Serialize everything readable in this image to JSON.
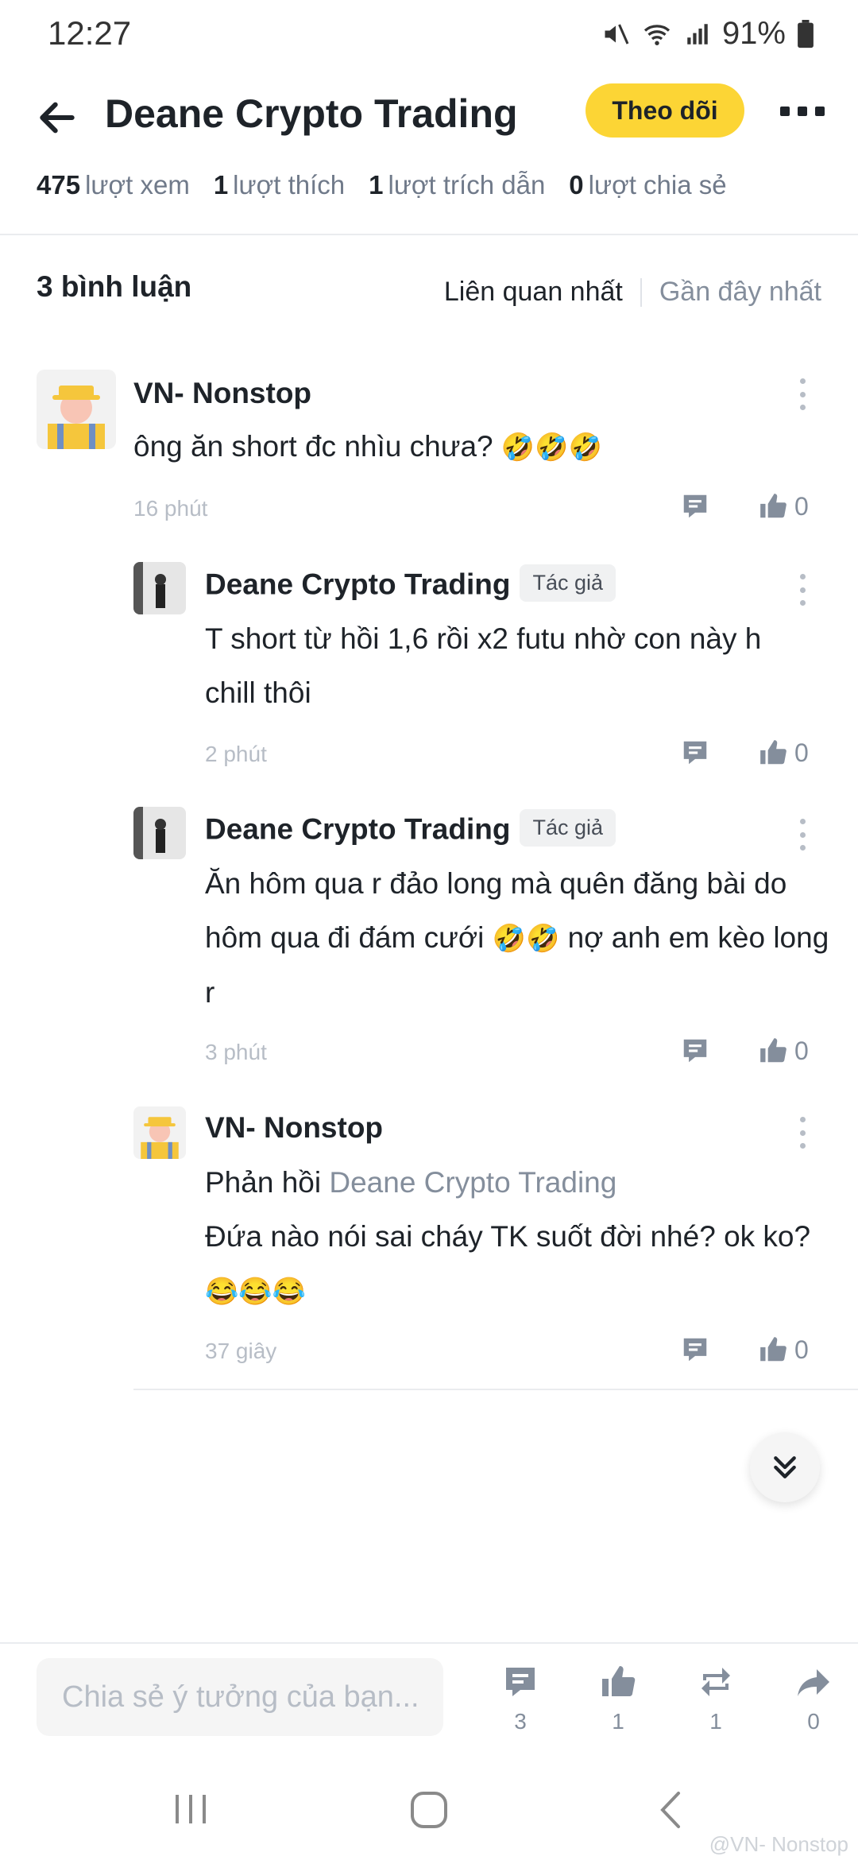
{
  "status_bar": {
    "time": "12:27",
    "battery": "91%"
  },
  "header": {
    "title": "Deane Crypto Trading",
    "follow_label": "Theo dõi"
  },
  "stats": {
    "views_count": "475",
    "views_label": "lượt xem",
    "likes_count": "1",
    "likes_label": "lượt thích",
    "quotes_count": "1",
    "quotes_label": "lượt trích dẫn",
    "shares_count": "0",
    "shares_label": "lượt chia sẻ"
  },
  "comments_header": {
    "count_label": "3 bình luận",
    "sort_relevant": "Liên quan nhất",
    "sort_recent": "Gần đây nhất"
  },
  "comments": [
    {
      "author": "VN- Nonstop",
      "text": "ông ăn short đc nhìu chưa?",
      "emoji": "🤣🤣🤣",
      "time": "16 phút",
      "likes": "0"
    },
    {
      "author": "Deane Crypto Trading",
      "badge": "Tác giả",
      "text": "T short từ hồi 1,6 rồi x2 futu nhờ con này h chill thôi",
      "time": "2 phút",
      "likes": "0"
    },
    {
      "author": "Deane Crypto Trading",
      "badge": "Tác giả",
      "text_a": "Ăn hôm qua r đảo long mà quên đăng bài do hôm qua đi đám cưới",
      "emoji": "🤣🤣",
      "text_b": "nợ anh em kèo long r",
      "time": "3 phút",
      "likes": "0"
    },
    {
      "author": "VN- Nonstop",
      "reply_prefix": "Phản hồi",
      "reply_to": "Deane Crypto Trading",
      "text": "Đứa nào nói sai cháy TK suốt đời nhé? ok ko?",
      "emoji": "😂😂😂",
      "time": "37 giây",
      "likes": "0"
    }
  ],
  "bottom_bar": {
    "input_placeholder": "Chia sẻ ý tưởng của bạn...",
    "comments_count": "3",
    "likes_count": "1",
    "reposts_count": "1",
    "shares_count": "0"
  },
  "watermark": "@VN- Nonstop",
  "colors": {
    "accent": "#fcd535",
    "text": "#1e2329",
    "muted": "#848e9c"
  }
}
